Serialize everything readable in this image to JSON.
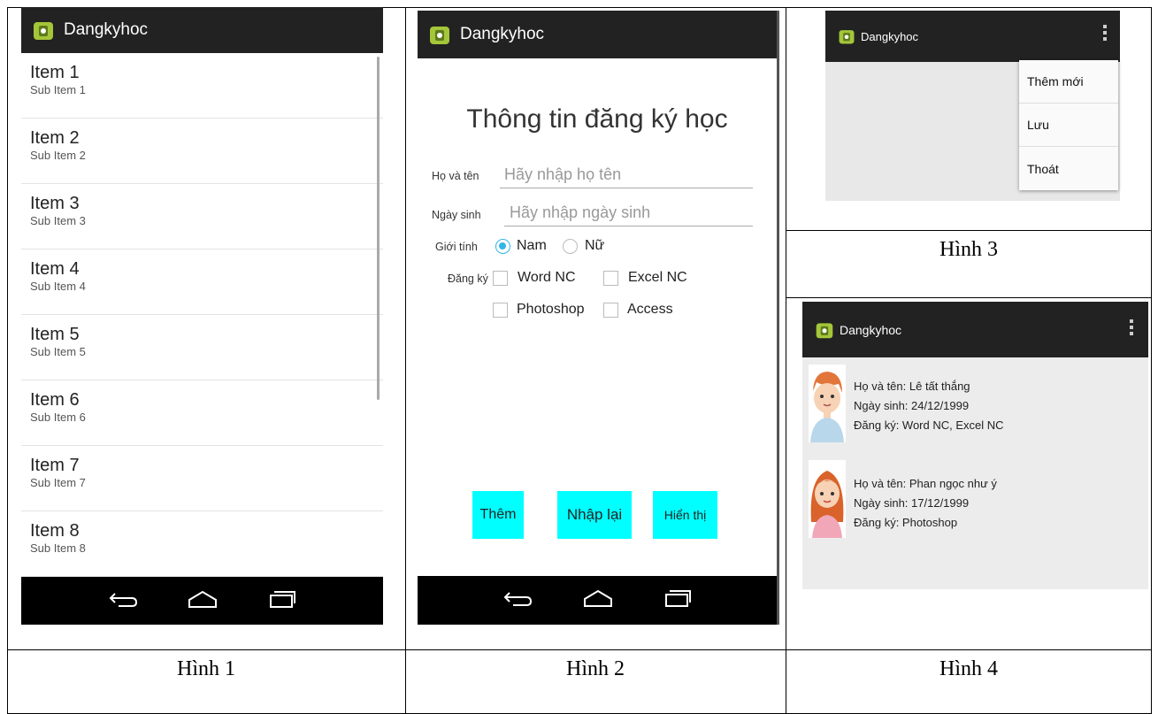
{
  "app": {
    "title": "Dangkyhoc"
  },
  "captions": {
    "h1": "Hình 1",
    "h2": "Hình 2",
    "h3": "Hình 3",
    "h4": "Hình 4"
  },
  "list": [
    {
      "title": "Item 1",
      "sub": "Sub Item 1"
    },
    {
      "title": "Item 2",
      "sub": "Sub Item 2"
    },
    {
      "title": "Item 3",
      "sub": "Sub Item 3"
    },
    {
      "title": "Item 4",
      "sub": "Sub Item 4"
    },
    {
      "title": "Item 5",
      "sub": "Sub Item 5"
    },
    {
      "title": "Item 6",
      "sub": "Sub Item 6"
    },
    {
      "title": "Item 7",
      "sub": "Sub Item 7"
    },
    {
      "title": "Item 8",
      "sub": "Sub Item 8"
    }
  ],
  "form": {
    "heading": "Thông tin đăng ký học",
    "name_label": "Họ và tên",
    "name_placeholder": "Hãy nhập họ tên",
    "dob_label": "Ngày sinh",
    "dob_placeholder": "Hãy nhập ngày sinh",
    "gender_label": "Giới tính",
    "gender_male": "Nam",
    "gender_female": "Nữ",
    "gender_selected": "Nam",
    "register_label": "Đăng ký",
    "courses": [
      "Word NC",
      "Excel NC",
      "Photoshop",
      "Access"
    ],
    "buttons": {
      "add": "Thêm",
      "reset": "Nhập lại",
      "show": "Hiển thị"
    }
  },
  "menu": {
    "items": [
      "Thêm mới",
      "Lưu",
      "Thoát"
    ]
  },
  "records": [
    {
      "name": "Họ và tên: Lê tất thắng",
      "dob": "Ngày sinh: 24/12/1999",
      "reg": "Đăng ký: Word NC, Excel NC"
    },
    {
      "name": "Họ và tên: Phan ngọc như ý",
      "dob": "Ngày sinh: 17/12/1999",
      "reg": "Đăng ký: Photoshop"
    }
  ],
  "colors": {
    "actionbar": "#222222",
    "accent": "#33b5e5",
    "button": "#00ffff",
    "android_green": "#a4c639"
  }
}
